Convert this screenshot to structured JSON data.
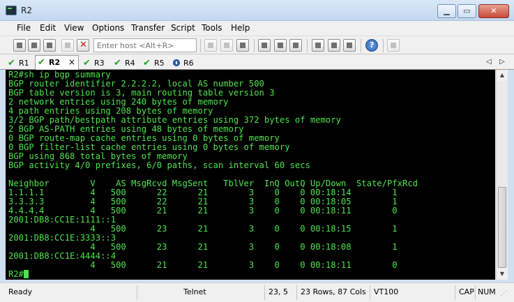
{
  "window": {
    "title": "R2"
  },
  "menu": [
    "File",
    "Edit",
    "View",
    "Options",
    "Transfer",
    "Script",
    "Tools",
    "Help"
  ],
  "toolbar": {
    "host_placeholder": "Enter host <Alt+R>"
  },
  "tabs": [
    {
      "label": "R1",
      "icon": "check-icon",
      "active": false
    },
    {
      "label": "R2",
      "icon": "check-icon",
      "active": true,
      "close": "×"
    },
    {
      "label": "R3",
      "icon": "check-icon",
      "active": false
    },
    {
      "label": "R4",
      "icon": "check-icon",
      "active": false
    },
    {
      "label": "R5",
      "icon": "check-icon",
      "active": false
    },
    {
      "label": "R6",
      "icon": "info-icon",
      "active": false
    }
  ],
  "tab_nav": {
    "prev": "◁",
    "next": "▷"
  },
  "terminal": {
    "text_color": "#4ee34e",
    "background": "#000000",
    "lines": [
      "R2#sh ip bgp summary",
      "BGP router identifier 2.2.2.2, local AS number 500",
      "BGP table version is 3, main routing table version 3",
      "2 network entries using 240 bytes of memory",
      "4 path entries using 208 bytes of memory",
      "3/2 BGP path/bestpath attribute entries using 372 bytes of memory",
      "2 BGP AS-PATH entries using 48 bytes of memory",
      "0 BGP route-map cache entries using 0 bytes of memory",
      "0 BGP filter-list cache entries using 0 bytes of memory",
      "BGP using 868 total bytes of memory",
      "BGP activity 4/0 prefixes, 6/0 paths, scan interval 60 secs",
      "",
      "Neighbor        V    AS MsgRcvd MsgSent   TblVer  InQ OutQ Up/Down  State/PfxRcd",
      "1.1.1.1         4   500      22      21        3    0    0 00:18:14        1",
      "3.3.3.3         4   500      22      21        3    0    0 00:18:05        1",
      "4.4.4.4         4   500      21      21        3    0    0 00:18:11        0",
      "2001:DB8:CC1E:1111::1",
      "                4   500      23      21        3    0    0 00:18:15        1",
      "2001:DB8:CC1E:3333::3",
      "                4   500      23      21        3    0    0 00:18:08        1",
      "2001:DB8:CC1E:4444::4",
      "                4   500      21      21        3    0    0 00:18:11        0"
    ],
    "prompt": "R2#"
  },
  "status": {
    "ready": "Ready",
    "protocol": "Telnet",
    "position": "23,  5",
    "size": "23 Rows, 87 Cols",
    "emulation": "VT100",
    "caps": "CAP",
    "num": "NUM"
  }
}
